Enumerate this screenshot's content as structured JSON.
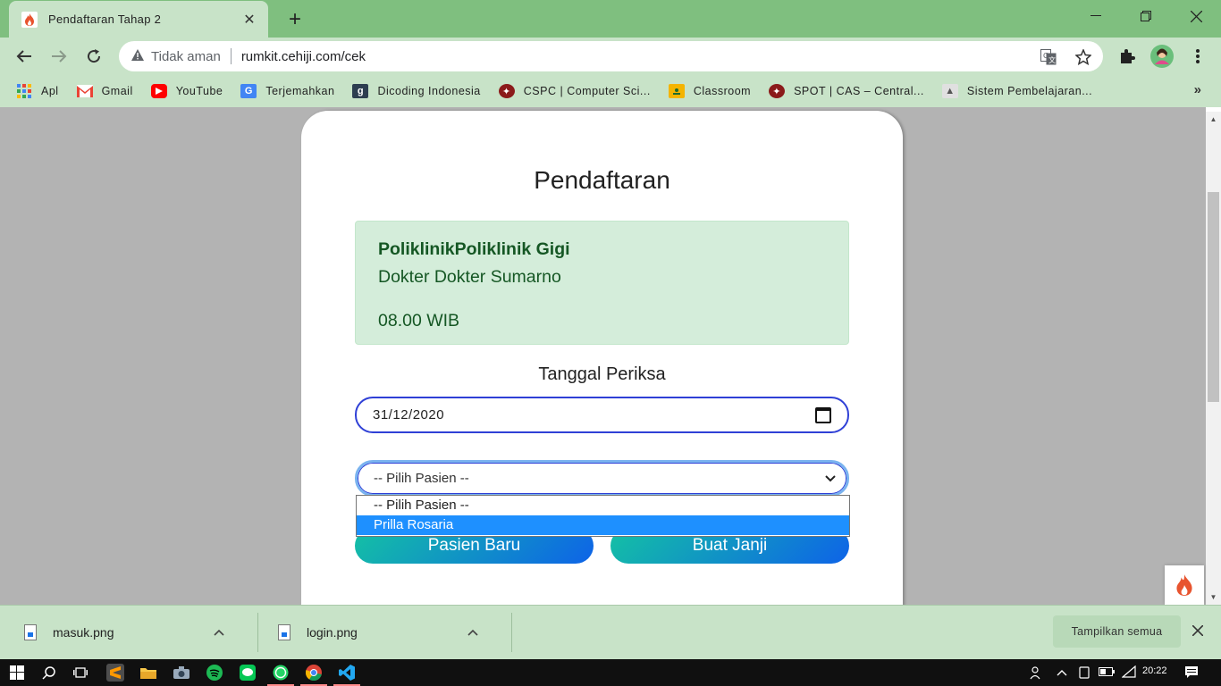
{
  "browser": {
    "tab_title": "Pendaftaran Tahap 2",
    "tab_close": "✕",
    "new_tab": "+",
    "omnibox": {
      "security_label": "Tidak aman",
      "url": "rumkit.cehiji.com/cek"
    },
    "bookmarks": [
      {
        "label": "Apl",
        "icon": "apps-grid-icon",
        "color": "#4285f4"
      },
      {
        "label": "Gmail",
        "icon": "gmail-icon",
        "color": "#ea4335"
      },
      {
        "label": "YouTube",
        "icon": "youtube-icon",
        "color": "#ff0000"
      },
      {
        "label": "Terjemahkan",
        "icon": "translate-icon",
        "color": "#4285f4"
      },
      {
        "label": "Dicoding Indonesia",
        "icon": "dicoding-icon",
        "color": "#2d3e50"
      },
      {
        "label": "CSPC | Computer Sci...",
        "icon": "cspc-icon",
        "color": "#8b1a1a"
      },
      {
        "label": "Classroom",
        "icon": "classroom-icon",
        "color": "#f4b400"
      },
      {
        "label": "SPOT | CAS – Central...",
        "icon": "spot-icon",
        "color": "#8b1a1a"
      },
      {
        "label": "Sistem Pembelajaran...",
        "icon": "sistem-icon",
        "color": "#777777"
      }
    ],
    "bookmarks_more": "»"
  },
  "page": {
    "title": "Pendaftaran",
    "info": {
      "poli": "PoliklinikPoliklinik Gigi",
      "dokter": "Dokter Dokter Sumarno",
      "jam": "08.00 WIB"
    },
    "date_label": "Tanggal Periksa",
    "date_value": "31/12/2020",
    "select": {
      "current": "-- Pilih Pasien --",
      "options": [
        "-- Pilih Pasien --",
        "Prilla Rosaria"
      ],
      "highlighted_index": 1
    },
    "buttons": {
      "new_patient": "Pasien Baru",
      "make_appointment": "Buat Janji"
    }
  },
  "downloads": {
    "items": [
      "masuk.png",
      "login.png"
    ],
    "show_all": "Tampilkan semua"
  },
  "taskbar": {
    "time": "20:22"
  },
  "colors": {
    "chrome_frame": "#7fbf7f",
    "chrome_toolbar": "#c8e3c8",
    "info_bg": "#d4edda",
    "info_text": "#155724",
    "button_gradient_start": "#14c1a4",
    "button_gradient_end": "#0d63e8",
    "dropdown_highlight": "#1e90ff"
  }
}
